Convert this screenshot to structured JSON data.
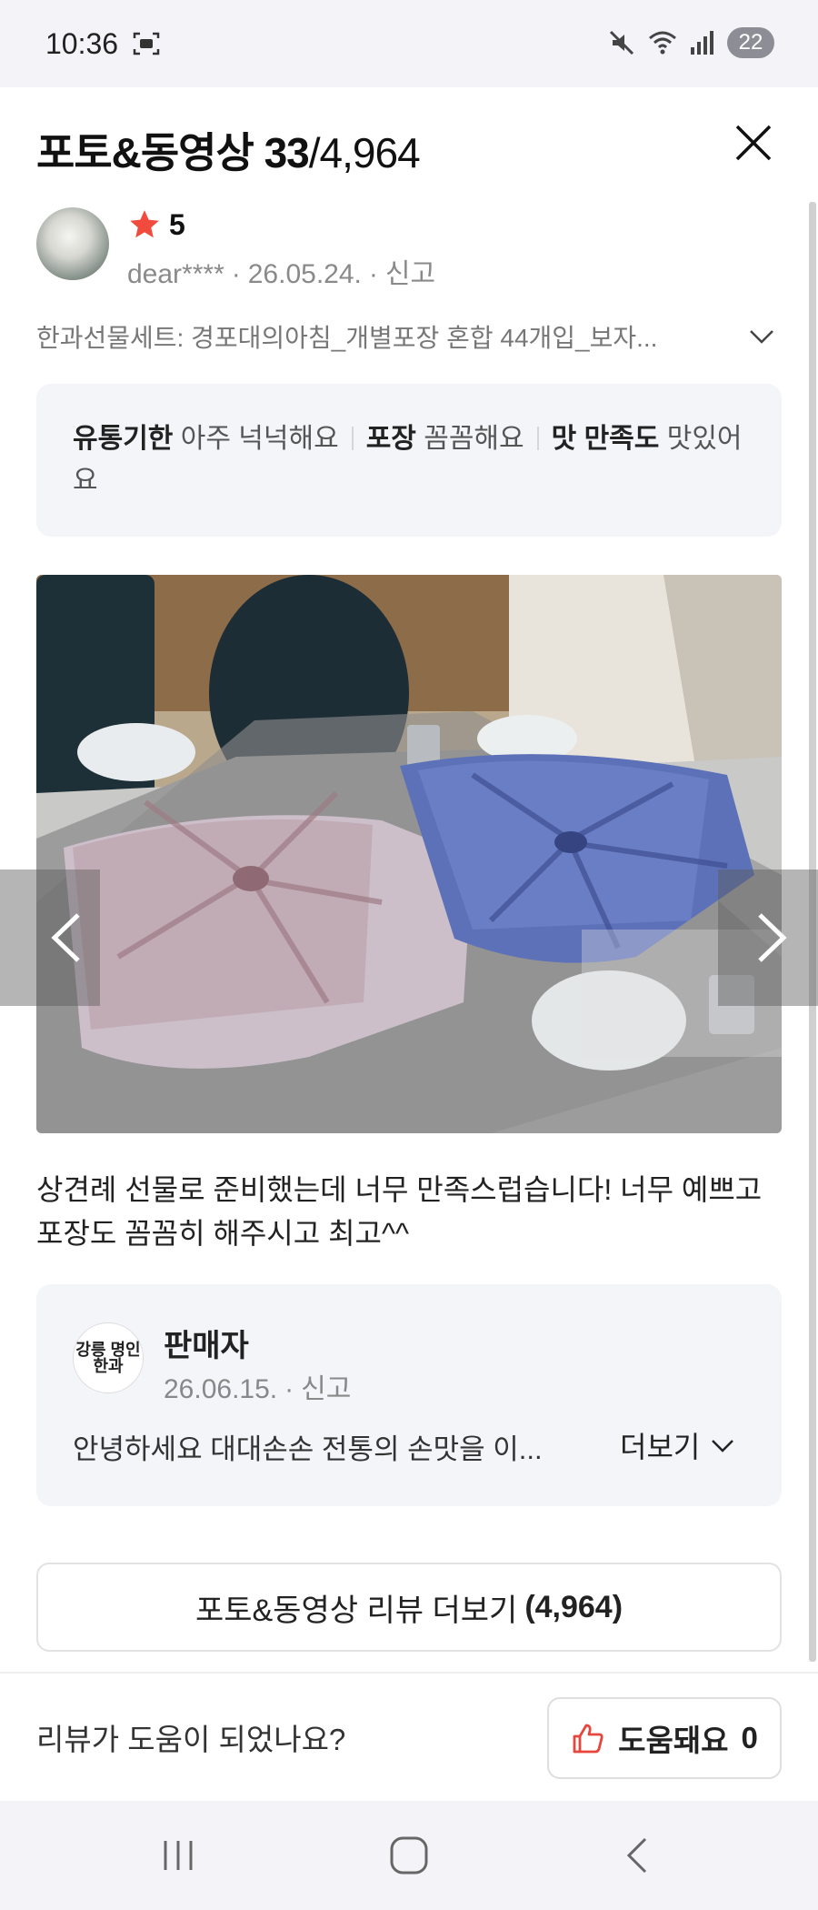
{
  "status_bar": {
    "time": "10:36",
    "battery": "22"
  },
  "header": {
    "title": "포토&동영상 33",
    "total": "/4,964"
  },
  "review": {
    "rating": "5",
    "user": "dear****",
    "date": "26.05.24.",
    "report": "신고",
    "option": "한과선물세트: 경포대의아침_개별포장 혼합 44개입_보자...",
    "attributes": [
      {
        "name": "유통기한",
        "value": "아주 넉넉해요"
      },
      {
        "name": "포장",
        "value": "꼼꼼해요"
      },
      {
        "name": "맛 만족도",
        "value": "맛있어요"
      }
    ],
    "text": "상견례 선물로 준비했는데 너무 만족스럽습니다! 너무 예쁘고 포장도 꼼꼼히 해주시고 최고^^"
  },
  "seller": {
    "logo_text": "강릉 명인 한과",
    "name": "판매자",
    "date": "26.06.15.",
    "report": "신고",
    "reply": "안녕하세요 대대손손 전통의 손맛을 이...",
    "more_label": "더보기"
  },
  "more_button": {
    "label": "포토&동영상 리뷰 더보기",
    "count": "(4,964)"
  },
  "helpful": {
    "question": "리뷰가 도움이 되었나요?",
    "label": "도움돼요",
    "count": "0"
  },
  "colors": {
    "star": "#f04b3c",
    "thumb": "#e8453c",
    "box_bg": "#f4f5f9"
  }
}
